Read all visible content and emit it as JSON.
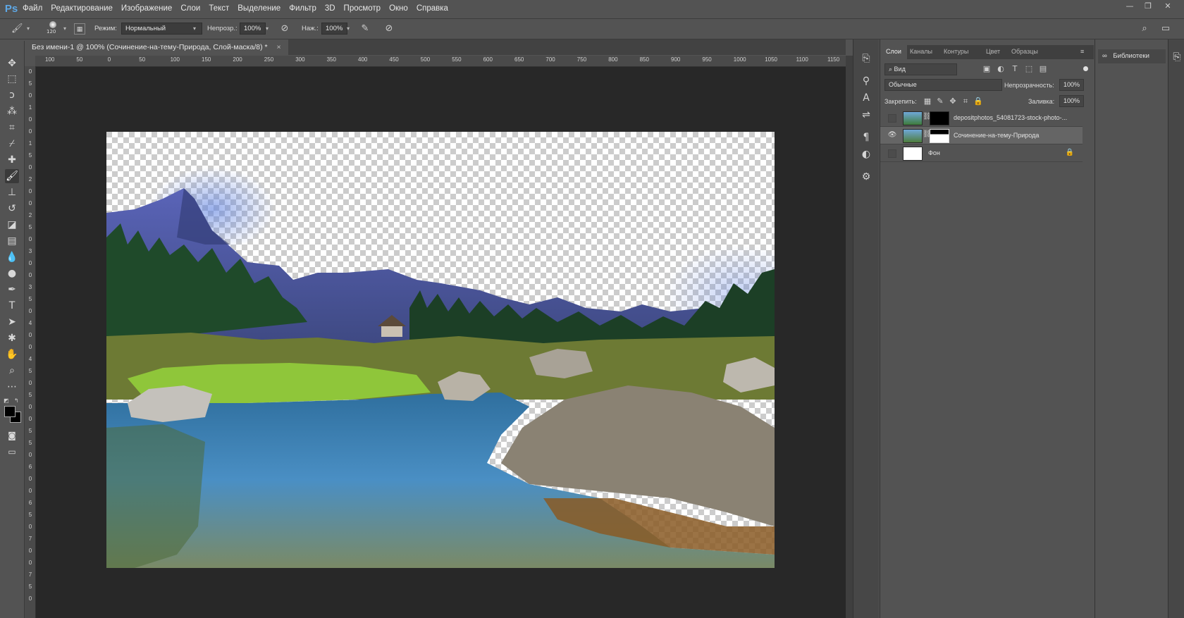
{
  "app": {
    "logo": "Ps"
  },
  "menu": [
    "Файл",
    "Редактирование",
    "Изображение",
    "Слои",
    "Текст",
    "Выделение",
    "Фильтр",
    "3D",
    "Просмотр",
    "Окно",
    "Справка"
  ],
  "options_bar": {
    "brush_size": "120",
    "mode_label": "Режим:",
    "mode_value": "Нормальный",
    "opacity_label": "Непрозр.:",
    "opacity_value": "100%",
    "pressure_label": "Наж.:",
    "pressure_value": "100%"
  },
  "document": {
    "tab_title": "Без имени-1 @ 100% (Сочинение-на-тему-Природа, Слой-маска/8) *",
    "close_glyph": "×",
    "ruler_ticks": [
      "100",
      "50",
      "0",
      "50",
      "100",
      "150",
      "200",
      "250",
      "300",
      "350",
      "400",
      "450",
      "500",
      "550",
      "600",
      "650",
      "700",
      "750",
      "800",
      "850",
      "900",
      "950",
      "1000",
      "1050",
      "1100",
      "1150"
    ],
    "vruler_ticks": [
      "0",
      "5",
      "0",
      "1",
      "0",
      "0",
      "1",
      "5",
      "0",
      "2",
      "0",
      "0",
      "2",
      "5",
      "0",
      "3",
      "0",
      "0",
      "3",
      "5",
      "0",
      "4",
      "0",
      "0",
      "4",
      "5",
      "0",
      "5",
      "0",
      "0",
      "5",
      "5",
      "0",
      "6",
      "0",
      "0",
      "6",
      "5",
      "0",
      "7",
      "0",
      "0",
      "7",
      "5",
      "0"
    ]
  },
  "layers_panel": {
    "tabs": [
      "Слои",
      "Каналы",
      "Контуры",
      "Цвет",
      "Образцы"
    ],
    "active_tab": "Слои",
    "filter": "Вид",
    "blend_mode": "Обычные",
    "opacity_label": "Непрозрачность:",
    "opacity_value": "100%",
    "lock_label": "Закрепить:",
    "fill_label": "Заливка:",
    "fill_value": "100%",
    "layers": [
      {
        "name": "depositphotos_54081723-stock-photo-...",
        "visible": false,
        "has_mask": true,
        "selected": false
      },
      {
        "name": "Сочинение-на-тему-Природа",
        "visible": true,
        "has_mask": true,
        "selected": true
      },
      {
        "name": "Фон",
        "visible": false,
        "has_mask": false,
        "selected": false,
        "locked": true
      }
    ]
  },
  "libraries": {
    "label": "Библиотеки"
  },
  "colors": {
    "ui_bg": "#535353",
    "canvas_bg": "#282828",
    "accent": "#5ea8e6"
  }
}
